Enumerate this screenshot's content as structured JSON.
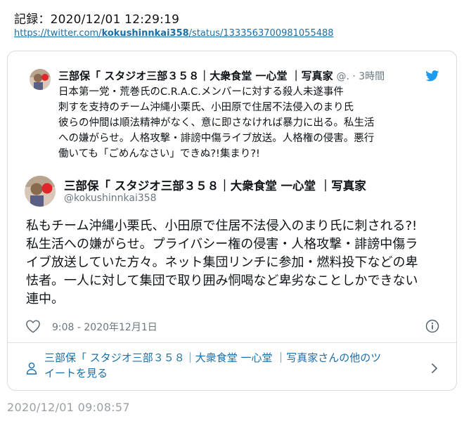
{
  "record": {
    "text": "記録：2020/12/01 12:29:19"
  },
  "source_url": {
    "prefix": "https://twitter.com/",
    "user": "kokushinnkai358",
    "suffix": "/status/1333563700981055488"
  },
  "quoted_tweet": {
    "author_name": "三部保「 スタジオ三部３５８｜大衆食堂 一心堂 ｜写真家",
    "handle_time": "@. · 3時間",
    "lines": [
      "日本第一党・荒巻氏のC.R.A.C.メンバーに対する殺人未遂事件",
      "刺すを支持のチーム沖縄小栗氏、小田原で住居不法侵入のまり氏",
      "彼らの仲間は順法精神がなく、意に即さなければ暴力に出る。私生活",
      "への嫌がらせ。人格攻撃・誹謗中傷ライブ放送。人格権の侵害。悪行",
      "働いても「ごめんなさい」できぬ?!集まり?!"
    ]
  },
  "main_tweet": {
    "author_name": "三部保「 スタジオ三部３５８｜大衆食堂 一心堂 ｜写真家",
    "handle": "@kokushinnkai358",
    "lines": [
      "私もチーム沖縄小栗氏、小田原で住居不法侵入のまり氏に刺される?!",
      "私生活への嫌がらせ。プライバシー権の侵害・人格攻撃・誹謗中傷ラ",
      "イブ放送していた方々。ネット集団リンチに参加・燃料投下などの卑",
      "怯者。一人に対して集団で取り囲み恫喝など卑劣なことしかできない",
      "連中。"
    ],
    "timestamp": "9:08 - 2020年12月1日"
  },
  "more_tweets": {
    "line1": "三部保「 スタジオ三部３５８｜大衆食堂 一心堂 ｜写真家さんの他のツ",
    "line2": "イートを見る"
  },
  "footer": {
    "timestamp": "2020/12/01 09:08:57"
  },
  "icons": {
    "bird": "twitter-bird-icon",
    "heart": "heart-icon",
    "info": "info-icon",
    "person": "person-icon",
    "chevron": "chevron-right-icon"
  },
  "colors": {
    "link": "#1b6ea8",
    "twitter_blue": "#1d9bf0",
    "muted": "#6b7781"
  }
}
